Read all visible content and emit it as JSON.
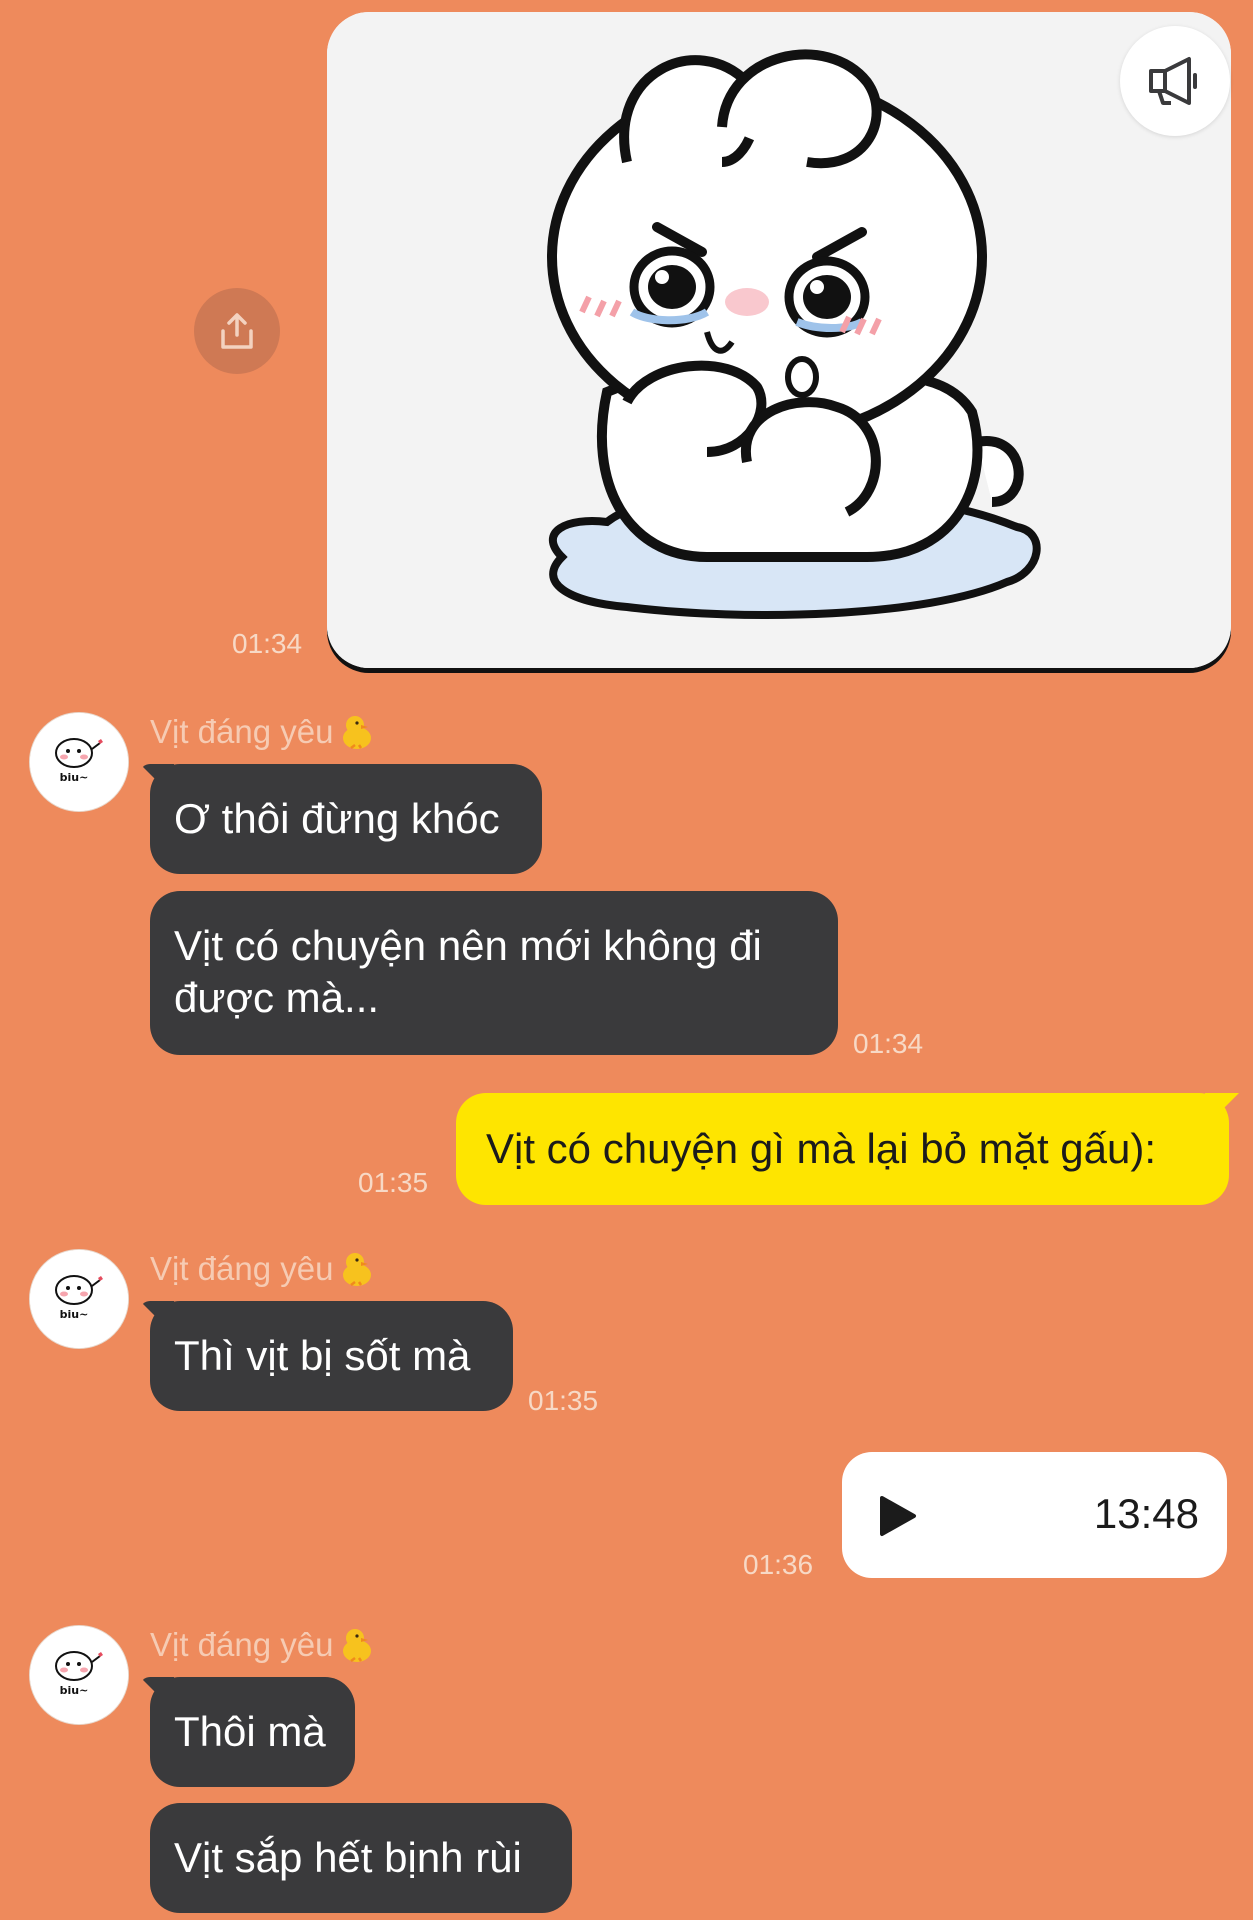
{
  "messages": {
    "sticker": {
      "time": "01:34"
    },
    "group1": {
      "sender": "Vịt đáng yêu",
      "msg1": "Ơ thôi đừng khóc",
      "msg2_line1": "Vịt có chuyện nên mới không đi",
      "msg2_line2": "được mà...",
      "time": "01:34"
    },
    "outgoing1": {
      "text": "Vịt có chuyện gì mà lại bỏ mặt gấu):",
      "time": "01:35"
    },
    "group2": {
      "sender": "Vịt đáng yêu",
      "msg1": "Thì vịt bị sốt mà",
      "time": "01:35"
    },
    "voice": {
      "duration": "13:48",
      "time": "01:36"
    },
    "group3": {
      "sender": "Vịt đáng yêu",
      "msg1": "Thôi mà",
      "msg2": "Vịt sắp hết bịnh rùi"
    }
  },
  "avatar_caption": "biu~",
  "colors": {
    "background": "#EE8A5C",
    "incoming_bubble": "#3A3A3C",
    "outgoing_bubble": "#FEE500",
    "timestamp": "#F7D9C6"
  },
  "icons": [
    "megaphone-icon",
    "share-icon",
    "play-icon",
    "chick-emoji",
    "avatar-image"
  ]
}
